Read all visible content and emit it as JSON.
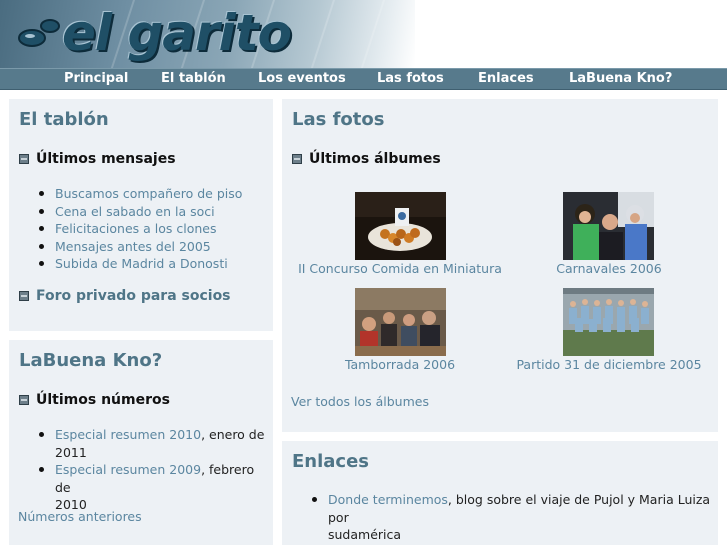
{
  "header": {
    "logo_text": "el garito"
  },
  "nav": [
    "Principal",
    "El tablón",
    "Los eventos",
    "Las fotos",
    "Enlaces",
    "LaBuena Kno?"
  ],
  "tablon": {
    "title": "El tablón",
    "section": "Últimos mensajes",
    "items": [
      "Buscamos compañero de piso",
      "Cena el sabado en la soci",
      "Felicitaciones a los clones",
      "Mensajes antes del 2005",
      "Subida de Madrid a Donosti"
    ],
    "foro": "Foro privado para socios"
  },
  "labuena": {
    "title": "LaBuena Kno?",
    "section": "Últimos números",
    "items": [
      {
        "link": "Especial resumen 2010",
        "rest": ", enero de",
        "rest2": "2011"
      },
      {
        "link": "Especial resumen 2009",
        "rest": ", febrero de",
        "rest2": "2010"
      }
    ],
    "more": "Números anteriores"
  },
  "fotos": {
    "title": "Las fotos",
    "section": "Últimos álbumes",
    "albums": [
      "II Concurso Comida en Miniatura",
      "Carnavales 2006",
      "Tamborrada 2006",
      "Partido 31 de diciembre 2005"
    ],
    "all": "Ver todos los álbumes"
  },
  "enlaces": {
    "title": "Enlaces",
    "items": [
      {
        "link": "Donde terminemos",
        "rest": ", blog sobre el viaje de Pujol y Maria Luiza por",
        "rest2": "sudamérica"
      }
    ]
  },
  "colors": {
    "nav_bg": "#577a8c",
    "panel_bg": "#edf1f5",
    "link": "#5b86a0",
    "heading": "#4f7587"
  }
}
